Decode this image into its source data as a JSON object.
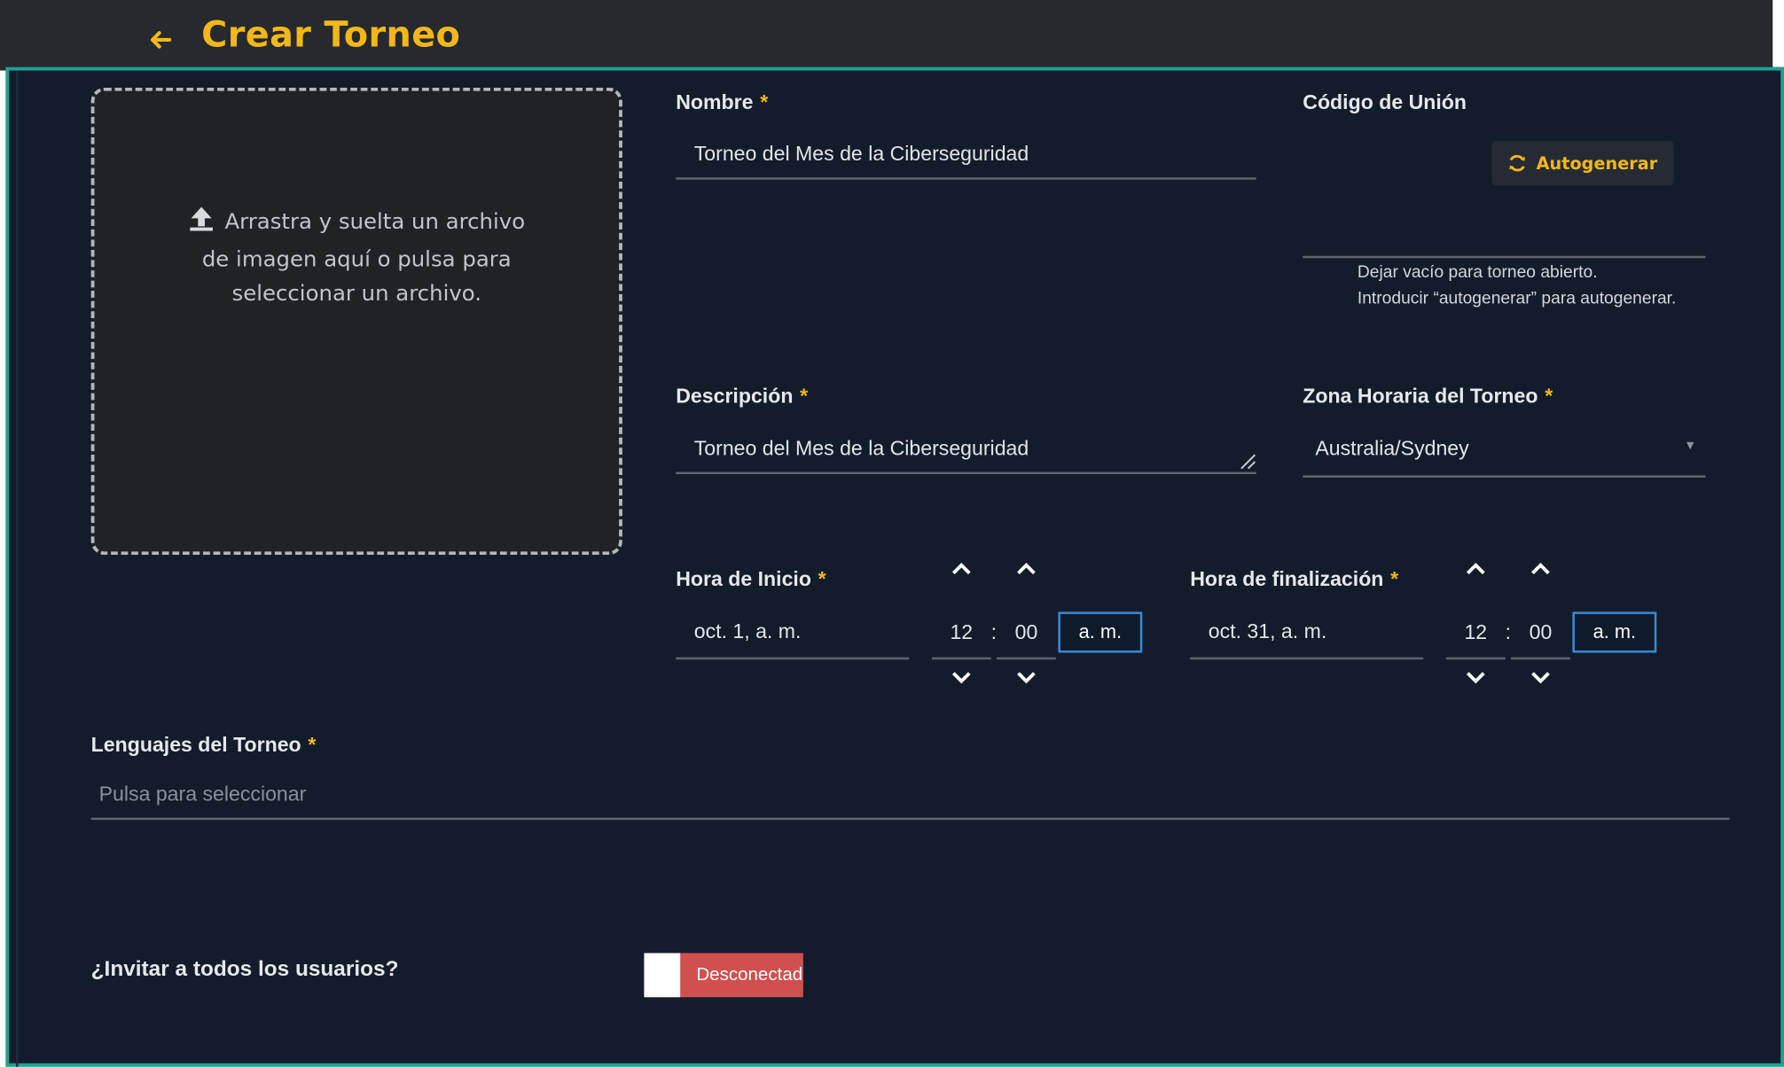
{
  "header": {
    "title": "Crear Torneo",
    "back_icon": "arrow-left-icon"
  },
  "dropzone": {
    "icon": "upload-icon",
    "line1": "Arrastra y suelta un archivo",
    "line2": "de imagen aquí o pulsa para",
    "line3": "seleccionar un archivo."
  },
  "form": {
    "required_mark": "*",
    "name": {
      "label": "Nombre",
      "value": "Torneo del Mes de la Ciberseguridad"
    },
    "join_code": {
      "label": "Código de Unión",
      "button": "Autogenerar",
      "button_icon": "refresh-icon",
      "value": "",
      "help_line1": "Dejar vacío para torneo abierto.",
      "help_line2": "Introducir “autogenerar” para autogenerar."
    },
    "description": {
      "label": "Descripción",
      "value": "Torneo del Mes de la Ciberseguridad"
    },
    "timezone": {
      "label": "Zona Horaria del Torneo",
      "value": "Australia/Sydney"
    },
    "start": {
      "label": "Hora de Inicio",
      "date": "oct. 1, a. m.",
      "hour": "12",
      "minute": "00",
      "separator": ":",
      "period": "a. m."
    },
    "end": {
      "label": "Hora de finalización",
      "date": "oct. 31, a. m.",
      "hour": "12",
      "minute": "00",
      "separator": ":",
      "period": "a. m."
    },
    "languages": {
      "label": "Lenguajes del Torneo",
      "placeholder": "Pulsa para seleccionar"
    },
    "invite": {
      "label": "¿Invitar a todos los usuarios?",
      "toggle_text": "Desconectado",
      "toggle_on": false
    }
  },
  "colors": {
    "accent": "#f2b718",
    "panel_bg": "#131c2b",
    "panel_border": "#1fa18e",
    "header_bg": "#26292e",
    "toggle_off": "#d04f4f",
    "focus_border": "#3a87d8"
  }
}
